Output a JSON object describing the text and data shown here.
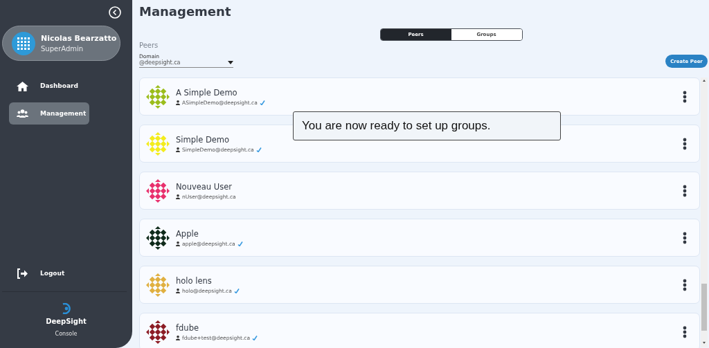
{
  "sidebar": {
    "user": {
      "name": "Nicolas Bearzatto",
      "role": "SuperAdmin"
    },
    "items": [
      {
        "label": "Dashboard",
        "selected": false
      },
      {
        "label": "Management",
        "selected": true
      }
    ],
    "logout": "Logout",
    "brand": {
      "name": "DeepSight",
      "subtitle": "Console"
    }
  },
  "page_title": "Management",
  "tabs": [
    {
      "label": "Peers",
      "selected": true
    },
    {
      "label": "Groups",
      "selected": false
    }
  ],
  "section_label": "Peers",
  "domain": {
    "label": "Domain",
    "value": "@deepsight.ca"
  },
  "create_button": "Create Peer",
  "peers": [
    {
      "name": "A Simple Demo",
      "email": "ASimpleDemo@deepsight.ca",
      "verified": true,
      "color": "#9bbd1b"
    },
    {
      "name": "Simple Demo",
      "email": "SimpleDemo@deepsight.ca",
      "verified": true,
      "color": "#f3ec1c"
    },
    {
      "name": "Nouveau User",
      "email": "nUser@deepsight.ca",
      "verified": false,
      "color": "#e8306d"
    },
    {
      "name": "Apple",
      "email": "apple@deepsight.ca",
      "verified": true,
      "color": "#0f2a1a"
    },
    {
      "name": "holo lens",
      "email": "holo@deepsight.ca",
      "verified": true,
      "color": "#e0b040"
    },
    {
      "name": "fdube",
      "email": "fdube+test@deepsight.ca",
      "verified": true,
      "color": "#8c1c24"
    }
  ],
  "tooltip": "You are now ready to set up groups."
}
